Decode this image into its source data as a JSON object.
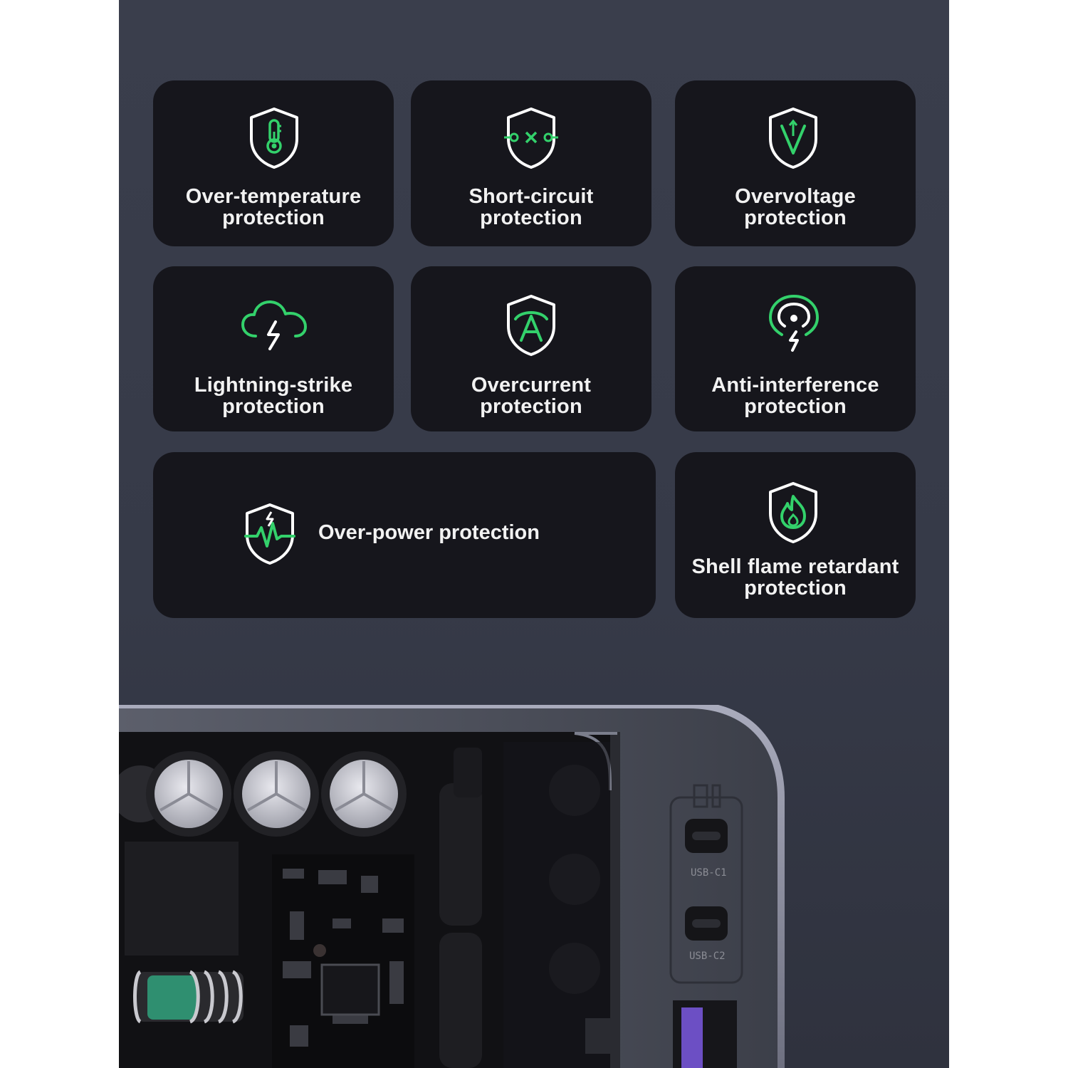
{
  "colors": {
    "accent": "#33d16b",
    "card_bg": "#16161c",
    "panel_bg": "#3a3e4c",
    "text": "#f2f2f2"
  },
  "features": [
    {
      "icon": "thermometer-shield-icon",
      "line1": "Over-temperature",
      "line2": "protection"
    },
    {
      "icon": "short-circuit-shield-icon",
      "line1": "Short-circuit",
      "line2": "protection"
    },
    {
      "icon": "voltage-shield-icon",
      "line1": "Overvoltage",
      "line2": "protection"
    },
    {
      "icon": "cloud-lightning-icon",
      "line1": "Lightning-strike",
      "line2": "protection"
    },
    {
      "icon": "current-shield-icon",
      "line1": "Overcurrent",
      "line2": "protection"
    },
    {
      "icon": "signal-bolt-icon",
      "line1": "Anti-interference",
      "line2": "protection"
    },
    {
      "icon": "pulse-shield-icon",
      "line1": "Over-power protection",
      "line2": ""
    },
    {
      "icon": "flame-shield-icon",
      "line1": "Shell flame retardant",
      "line2": "protection"
    }
  ],
  "product": {
    "port_c1": "USB-C1",
    "port_c2": "USB-C2"
  }
}
